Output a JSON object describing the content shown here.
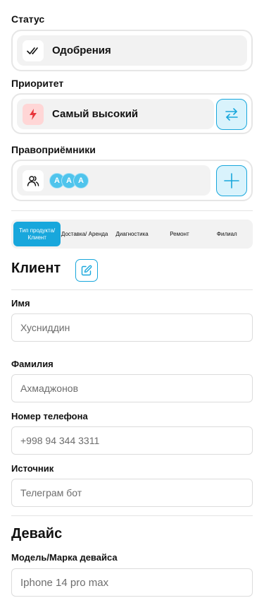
{
  "status": {
    "label": "Статус",
    "value": "Одобрения",
    "icon": "double-check-icon"
  },
  "priority": {
    "label": "Приоритет",
    "value": "Самый высокий",
    "icon": "lightning-icon",
    "icon_color": "#e8343a",
    "action_icon": "swap-arrows-icon"
  },
  "assignees": {
    "label": "Правоприёмники",
    "icon": "users-icon",
    "avatars": [
      "A",
      "A",
      "A"
    ],
    "action_icon": "plus-icon"
  },
  "tabs": [
    {
      "label": "Тип продукта/ Клиент",
      "active": true
    },
    {
      "label": "Доставка/ Аренда",
      "active": false
    },
    {
      "label": "Диагностика",
      "active": false
    },
    {
      "label": "Ремонт",
      "active": false
    },
    {
      "label": "Филиал",
      "active": false
    }
  ],
  "client": {
    "title": "Клиент",
    "edit_icon": "edit-icon",
    "fields": {
      "first_name": {
        "label": "Имя",
        "placeholder": "Хусниддин"
      },
      "last_name": {
        "label": "Фамилия",
        "placeholder": "Ахмаджонов"
      },
      "phone": {
        "label": "Номер телефона",
        "placeholder": "+998 94 344 3311"
      },
      "source": {
        "label": "Источник",
        "placeholder": "Телеграм бот"
      }
    }
  },
  "device": {
    "title": "Девайс",
    "model": {
      "label": "Модель/Марка девайса",
      "placeholder": "Iphone 14 pro max"
    }
  },
  "colors": {
    "accent": "#18a7dc",
    "accent_light": "#d9f3fc",
    "priority_bg": "#ffd6d6"
  }
}
